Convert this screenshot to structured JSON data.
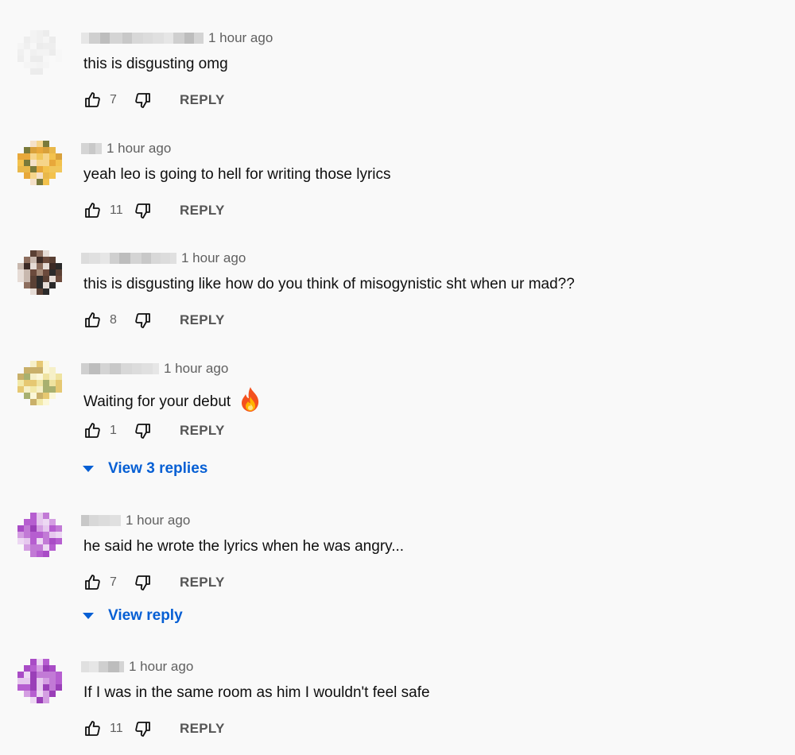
{
  "colors": {
    "background": "#f9f9f9",
    "link": "#065fd4",
    "secondary_text": "#606060"
  },
  "comments": [
    {
      "time": "1 hour ago",
      "text": "this is disgusting omg",
      "likes": "7",
      "reply_label": "REPLY",
      "has_emoji": false,
      "view_replies": ""
    },
    {
      "time": "1 hour ago",
      "text": "yeah leo is going to hell for writing those lyrics",
      "likes": "11",
      "reply_label": "REPLY",
      "has_emoji": false,
      "view_replies": ""
    },
    {
      "time": "1 hour ago",
      "text": "this is disgusting like how do you think of misogynistic sht when ur mad??",
      "likes": "8",
      "reply_label": "REPLY",
      "has_emoji": false,
      "view_replies": ""
    },
    {
      "time": "1 hour ago",
      "text": "Waiting for your debut",
      "likes": "1",
      "reply_label": "REPLY",
      "has_emoji": true,
      "emoji_icon": "fire-icon",
      "view_replies": "View 3 replies"
    },
    {
      "time": "1 hour ago",
      "text": "he said he wrote the lyrics when he was angry...",
      "likes": "7",
      "reply_label": "REPLY",
      "has_emoji": false,
      "view_replies": "View reply"
    },
    {
      "time": "1 hour ago",
      "text": "If I was in the same room as him I wouldn't feel safe",
      "likes": "11",
      "reply_label": "REPLY",
      "has_emoji": false,
      "view_replies": ""
    }
  ]
}
